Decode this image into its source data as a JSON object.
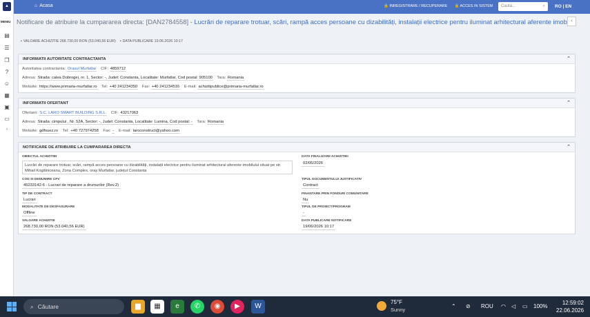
{
  "topbar": {
    "home_label": "Acasa",
    "link_register": "INREGISTRARE / RECUPERARE",
    "link_access": "ACCES IN SISTEM",
    "search_placeholder": "Cauta...",
    "lang": "RO | EN"
  },
  "sidebar": {
    "menu_label": "MENIU"
  },
  "notice": {
    "title_prefix": "Notificare de atribuire la cumpararea directa: [DAN2784558] - ",
    "title_highlight": "Lucrări de reparare trotuar, scări, rampă acces persoane cu dizabilități, instalații electrice pentru iluminat arhitectural aferente imobilului situat pe str. Mihail Kogălniceanu",
    "value_label": "VALOARE ACHIZITIE 268.730,00 RON (53.040,56 EUR)",
    "date_label": "DATA PUBLICARE 19.06.2026 10:17"
  },
  "authority": {
    "heading": "INFORMATII AUTORITATE CONTRACTANTA",
    "authority_label": "Autoritatea contractanta:",
    "authority_value": "Orasul Murfatlar",
    "cif_label": "CIF:",
    "cif_value": "4859712",
    "address_label": "Adresa:",
    "address_value": "Strada: calea Dobrogei, nr. 1, Sector: -, Judet: Constanta, Localitate: Murfatlar, Cod postal: 905100",
    "country_label": "Tara:",
    "country_value": "Romania",
    "website_label": "Website:",
    "website_value": "https://www.primaria-murfatlar.ro",
    "tel_label": "Tel:",
    "tel_value": "+40 241234350",
    "fax_label": "Fax:",
    "fax_value": "+40 241234516",
    "email_label": "E-mail:",
    "email_value": "achizitipublice@primaria-murfatlar.ro"
  },
  "supplier": {
    "heading": "INFORMATII OFERTANT",
    "supplier_label": "Ofertant:",
    "supplier_value": "S.C. LARO SMART BUILDING S.R.L.",
    "cif_label": "CIF:",
    "cif_value": "43217063",
    "address_label": "Adresa:",
    "address_value": "Strada: cimpului , Nr. 52A, Sector: -, Judet: Constanta, Localitate: Lumina, Cod postal: -",
    "country_label": "Tara:",
    "country_value": "Romania",
    "website_label": "Website:",
    "website_value": "gdfsuez.ro",
    "tel_label": "Tel:",
    "tel_value": "+40 727974258",
    "fax_label": "Fax:",
    "fax_value": "-",
    "email_label": "E-mail:",
    "email_value": "laroconstruct@yahoo.com"
  },
  "award": {
    "heading": "NOTIFICARE DE ATRIBUIRE LA CUMPARAREA DIRECTA",
    "object_label": "OBIECTUL ACHIZITIEI",
    "object_value": "Lucrări de reparare trotuar, scări, rampă acces persoane cu dizabilități, instalații electrice pentru iluminat arhitectural aferente imobilului situat pe str. Mihail Kogălniceanu, Zona Complex, oraș Murfatlar, județul Constanta",
    "end_date_label": "DATA FINALIZARII ACHIZITIEI",
    "end_date_value": "02/06/2026",
    "cpv_label": "COD SI DENUMIRE CPV",
    "cpv_value": "45233142-6 - Lucrari de reparare a drumurilor (Rev.2)",
    "doc_type_label": "TIPUL DOCUMENTULUI JUSTIFICATIV",
    "doc_type_value": "Contract",
    "contract_type_label": "TIP DE CONTRACT",
    "contract_type_value": "Lucrari",
    "eu_funds_label": "FINANTARE PRIN FONDURI COMUNITARE",
    "eu_funds_value": "Nu",
    "mode_label": "MODALITATE DE DESFASURARE",
    "mode_value": "Offline",
    "project_type_label": "TIPUL DE PROIECT/PROGRAM",
    "project_type_value": "-",
    "value_label": "VALOARE ACHIZITIE",
    "value_value": "268.730,00 RON (53.040,56 EUR)",
    "pub_date_label": "DATA PUBLICARE NOTIFICARE",
    "pub_date_value": "19/06/2026 10:17"
  },
  "taskbar": {
    "search_label": "Căutare",
    "weather_temp": "75°F",
    "weather_cond": "Sunny",
    "lang": "ROU",
    "battery": "100%",
    "time": "12:59:02",
    "date": "22.06.2026"
  }
}
